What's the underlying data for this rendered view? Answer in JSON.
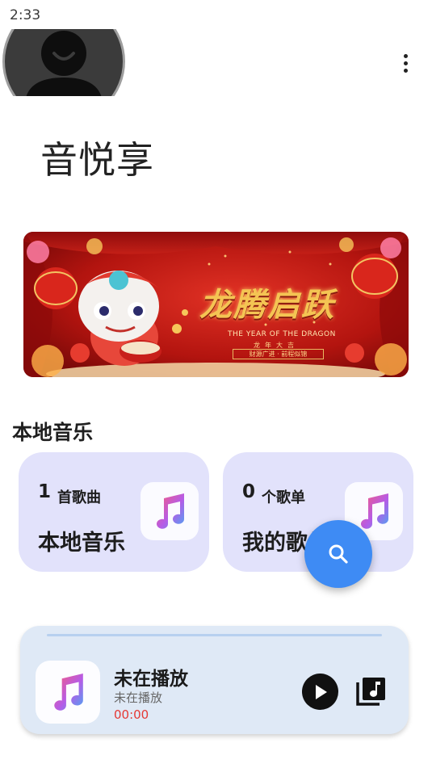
{
  "status_bar": {
    "time": "2:33"
  },
  "header": {
    "avatar_icon": "user-avatar-icon",
    "menu_icon": "more-vert-icon"
  },
  "app_title": "音悦享",
  "banner": {
    "calligraphy": "龙腾启跃",
    "english": "THE YEAR OF THE DRAGON",
    "subtitle_line1": "龙年大吉",
    "subtitle_line2": "财源广进 · 前程似锦"
  },
  "local_music": {
    "section_title": "本地音乐",
    "cards": [
      {
        "count": "1",
        "unit": "首歌曲",
        "name": "本地音乐",
        "icon": "music-note-icon"
      },
      {
        "count": "0",
        "unit": "个歌单",
        "name": "我的歌单",
        "icon": "music-note-icon"
      }
    ]
  },
  "fab": {
    "icon": "search-icon"
  },
  "player": {
    "title": "未在播放",
    "subtitle": "未在播放",
    "time": "00:00",
    "play_icon": "play-icon",
    "queue_icon": "queue-music-icon"
  },
  "colors": {
    "card_bg": "#e2e2fb",
    "fab": "#3e8bf4",
    "player_bg": "#dfe9f6",
    "time_accent": "#e53935"
  }
}
